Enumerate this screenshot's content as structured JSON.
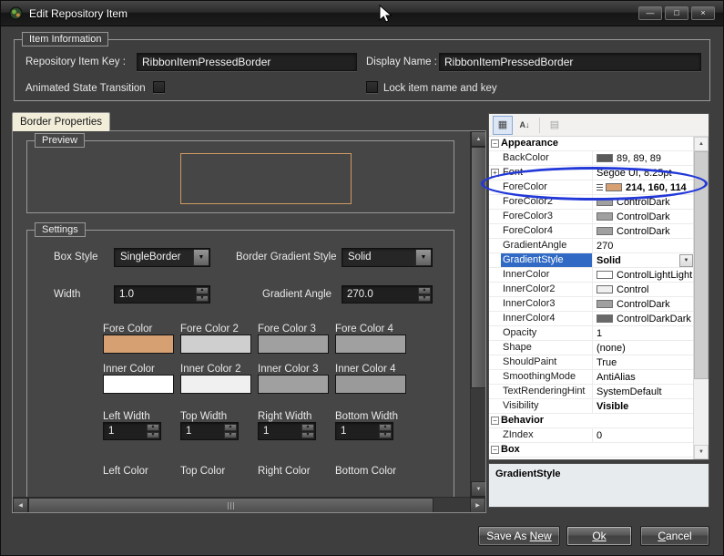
{
  "window": {
    "title": "Edit Repository Item",
    "minimize_glyph": "—",
    "maximize_glyph": "□",
    "close_glyph": "×"
  },
  "icons": {
    "up_arrow": "▲",
    "down_arrow": "▼",
    "left_arrow": "◀",
    "right_arrow": "▶",
    "dropdown_arrow": "▼",
    "collapse_glyph": "−",
    "expand_glyph": "+"
  },
  "item_information": {
    "group_label": "Item Information",
    "repository_item_key": {
      "label": "Repository Item Key :",
      "value": "RibbonItemPressedBorder"
    },
    "display_name": {
      "label": "Display Name :",
      "value": "RibbonItemPressedBorder"
    },
    "animated_state_transition": {
      "label": "Animated State Transition",
      "checked": false
    },
    "lock_item": {
      "label": "Lock item name and key",
      "checked": false
    }
  },
  "tabs": {
    "border_properties": "Border Properties"
  },
  "preview": {
    "group_label": "Preview",
    "border_color": "#CE9A63"
  },
  "settings": {
    "group_label": "Settings",
    "box_style": {
      "label": "Box Style",
      "value": "SingleBorder"
    },
    "border_gradient_style": {
      "label": "Border Gradient Style",
      "value": "Solid"
    },
    "width": {
      "label": "Width",
      "value": "1.0"
    },
    "gradient_angle": {
      "label": "Gradient Angle",
      "value": "270.0"
    },
    "fore_colors": [
      {
        "label": "Fore Color",
        "color": "#D6A072"
      },
      {
        "label": "Fore Color 2",
        "color": "#CFCFCF"
      },
      {
        "label": "Fore Color 3",
        "color": "#A0A0A0"
      },
      {
        "label": "Fore Color 4",
        "color": "#A0A0A0"
      }
    ],
    "inner_colors": [
      {
        "label": "Inner Color",
        "color": "#FFFFFF"
      },
      {
        "label": "Inner Color 2",
        "color": "#F0F0F0"
      },
      {
        "label": "Inner Color 3",
        "color": "#A0A0A0"
      },
      {
        "label": "Inner Color 4",
        "color": "#9A9A9A"
      }
    ],
    "side_widths": [
      {
        "label": "Left Width",
        "value": "1"
      },
      {
        "label": "Top Width",
        "value": "1"
      },
      {
        "label": "Right Width",
        "value": "1"
      },
      {
        "label": "Bottom Width",
        "value": "1"
      }
    ],
    "side_color_labels": [
      "Left Color",
      "Top Color",
      "Right Color",
      "Bottom Color"
    ]
  },
  "property_grid": {
    "toolbar": {
      "categorized_icon": "▦",
      "alphabetical_icon": "A↓",
      "property_pages_icon": "▤"
    },
    "rows": [
      {
        "cat": "Appearance"
      },
      {
        "name": "BackColor",
        "value": "89, 89, 89",
        "swatch": "#595959"
      },
      {
        "name": "Font",
        "value": "Segoe UI, 8.25pt",
        "expand": true
      },
      {
        "name": "ForeColor",
        "value": "214, 160, 114",
        "swatch": "#D6A072",
        "bold": true,
        "modified": true
      },
      {
        "name": "ForeColor2",
        "value": "ControlDark",
        "swatch": "#A0A0A0"
      },
      {
        "name": "ForeColor3",
        "value": "ControlDark",
        "swatch": "#A0A0A0"
      },
      {
        "name": "ForeColor4",
        "value": "ControlDark",
        "swatch": "#A0A0A0"
      },
      {
        "name": "GradientAngle",
        "value": "270"
      },
      {
        "name": "GradientStyle",
        "value": "Solid",
        "selected": true,
        "bold": true,
        "dropdown": true
      },
      {
        "name": "InnerColor",
        "value": "ControlLightLight",
        "swatch": "#FFFFFF"
      },
      {
        "name": "InnerColor2",
        "value": "Control",
        "swatch": "#F0F0F0"
      },
      {
        "name": "InnerColor3",
        "value": "ControlDark",
        "swatch": "#A0A0A0"
      },
      {
        "name": "InnerColor4",
        "value": "ControlDarkDark",
        "swatch": "#696969"
      },
      {
        "name": "Opacity",
        "value": "1"
      },
      {
        "name": "Shape",
        "value": "(none)"
      },
      {
        "name": "ShouldPaint",
        "value": "True"
      },
      {
        "name": "SmoothingMode",
        "value": "AntiAlias"
      },
      {
        "name": "TextRenderingHint",
        "value": "SystemDefault"
      },
      {
        "name": "Visibility",
        "value": "Visible",
        "bold": true
      },
      {
        "cat": "Behavior"
      },
      {
        "name": "ZIndex",
        "value": "0"
      },
      {
        "cat": "Box"
      }
    ],
    "description": {
      "title": "GradientStyle"
    }
  },
  "buttons": {
    "save_as_new": {
      "pre": "Save As ",
      "key": "New",
      "post": ""
    },
    "ok": {
      "pre": "",
      "key": "Ok",
      "post": ""
    },
    "cancel": {
      "pre": "",
      "key": "C",
      "post": "ancel"
    }
  },
  "annotation": {
    "ellipse_color": "#2238D8"
  }
}
